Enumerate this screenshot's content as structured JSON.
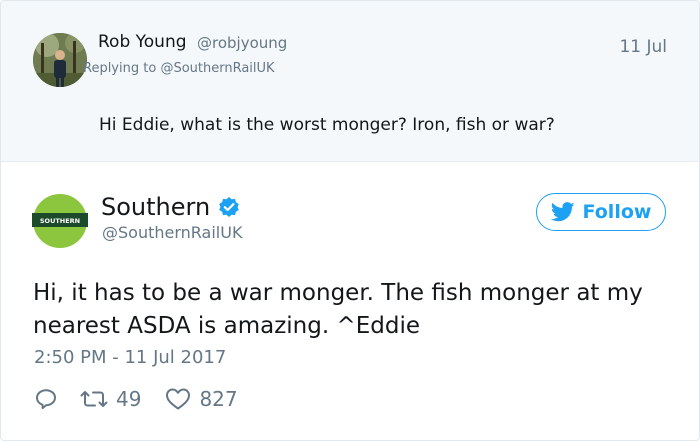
{
  "parent_tweet": {
    "author_name": "Rob Young",
    "author_handle": "@robjyoung",
    "replying_prefix": "Replying to ",
    "replying_to": "@SouthernRailUK",
    "date": "11 Jul",
    "text": "Hi Eddie, what is the worst monger? Iron, fish or war?"
  },
  "main_tweet": {
    "author_name": "Southern",
    "author_handle": "@SouthernRailUK",
    "logo_text": "SOUTHERN",
    "follow_label": "Follow",
    "text": "Hi, it has to be a war monger. The fish monger at my nearest ASDA is amazing. ^Eddie",
    "timestamp": "2:50 PM - 11 Jul 2017",
    "retweets": "49",
    "likes": "827"
  },
  "colors": {
    "accent": "#1da1f2",
    "secondary_text": "#657786",
    "southern_green": "#8cc63f",
    "southern_dark": "#1d4a2a"
  },
  "icons": [
    "verified-icon",
    "twitter-bird-icon",
    "reply-icon",
    "retweet-icon",
    "like-icon"
  ]
}
